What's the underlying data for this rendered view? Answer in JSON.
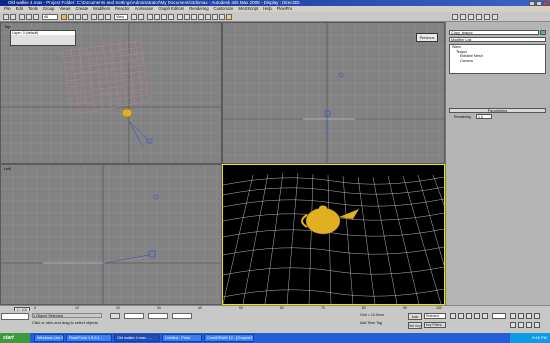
{
  "window": {
    "title": "Old walkie 4.max - Project Folder: C:\\Documents and Settings\\Administrator\\My Documents\\3dsmax - Autodesk 3ds Max 2008 - Display : Direct3D"
  },
  "menubar": {
    "items": [
      "File",
      "Edit",
      "Tools",
      "Group",
      "Views",
      "Create",
      "Modifiers",
      "Reactor",
      "Animation",
      "Graph Editors",
      "Rendering",
      "Customize",
      "MAXScript",
      "Help",
      "FlexiPro"
    ]
  },
  "toolbar": {
    "selection_filter": "All",
    "view_dropdown": "View"
  },
  "floater": {
    "title": "Layer: 0 (default)"
  },
  "viewports": {
    "top_left": {
      "label": "Top"
    },
    "top_right": {
      "label": "",
      "button": "Previous"
    },
    "bottom_left": {
      "label": "Left"
    },
    "bottom_right": {
      "label": ""
    }
  },
  "command_panel": {
    "object_name": "Copy_teapot",
    "modifier_list": "Modifier List",
    "stack": [
      "Teapot",
      "Editable Mesh",
      "Camera"
    ],
    "stack_secondary": "Wave",
    "rollout": "Parameters",
    "param_label": "Rendering",
    "param_value": "1.0"
  },
  "timeline": {
    "counter": "0 / 100",
    "ticks": [
      "0",
      "10",
      "20",
      "30",
      "40",
      "50",
      "60",
      "70",
      "80",
      "90",
      "100"
    ]
  },
  "status": {
    "selection": "1 Object Selected",
    "prompt": "Click or click-and-drag to select objects",
    "grid": "Grid = 10.0mm",
    "auto_key": "Auto Key",
    "set_key": "Set Key",
    "key_filter": "Selected",
    "key_filters_btn": "Key Filters...",
    "add_time_tag": "Add Time Tag"
  },
  "taskbar": {
    "start": "start",
    "tasks": [
      "Windows Live Messenger",
      "FlashPoint 1.5.6.1 ...",
      "Old walkie 4.max - ...",
      "Untitled - Paint",
      "CorelDRAW 12 - [Graphic1]"
    ],
    "clock": "9:45 PM"
  },
  "colors": {
    "viewport_bg": "#828282",
    "perspective_bg": "#000000",
    "active_border": "#e8e800",
    "teapot": "#e0b020",
    "grid_pink": "#c080a0",
    "grid_white": "#e6e6f0"
  }
}
